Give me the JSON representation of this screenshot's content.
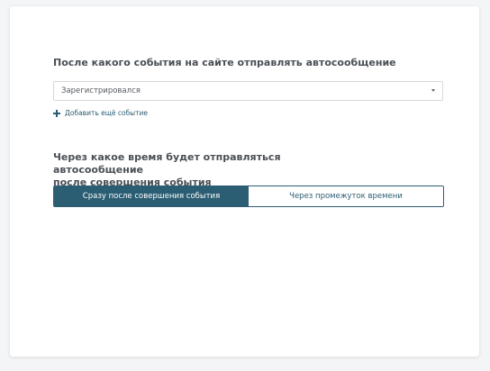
{
  "event_section": {
    "heading": "После какого события на сайте отправлять автосообщение",
    "selected_event": "Зарегистрировался",
    "add_event_label": "Добавить ещё событие"
  },
  "timing_section": {
    "heading_line1": "Через какое время будет отправляться автосообщение",
    "heading_line2": "после совершения события",
    "options": [
      {
        "label": "Сразу после совершения события",
        "selected": true
      },
      {
        "label": "Через промежуток времени",
        "selected": false
      }
    ]
  },
  "colors": {
    "accent": "#2b5d73",
    "heading_text": "#4a4f55",
    "background": "#f4f5f6"
  }
}
